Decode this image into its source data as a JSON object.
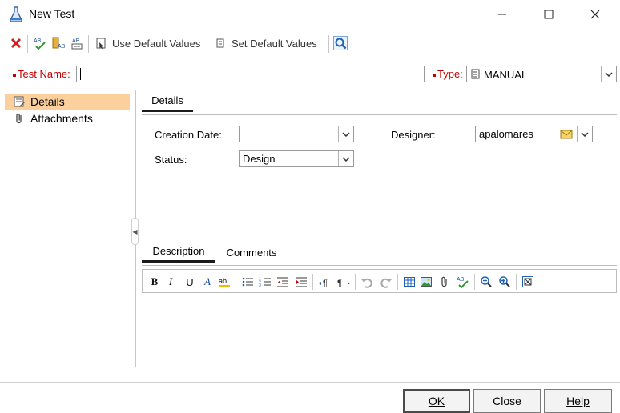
{
  "window": {
    "title": "New Test",
    "controls": {
      "minimize": "minimize-icon",
      "maximize": "maximize-icon",
      "close": "close-icon"
    }
  },
  "toolbar": {
    "use_default_label": "Use Default Values",
    "set_default_label": "Set Default Values",
    "icons": [
      "delete-icon",
      "spell-check-icon",
      "thesaurus-icon",
      "spelling-options-icon",
      "use-default-icon",
      "set-default-icon",
      "search-icon"
    ]
  },
  "form": {
    "test_name_label": "Test Name:",
    "test_name_value": "",
    "type_label": "Type:",
    "type_value": "MANUAL"
  },
  "sidebar": {
    "items": [
      {
        "label": "Details",
        "icon": "details-icon",
        "selected": true
      },
      {
        "label": "Attachments",
        "icon": "paperclip-icon",
        "selected": false
      }
    ]
  },
  "details": {
    "tab_label": "Details",
    "creation_date_label": "Creation Date:",
    "creation_date_value": "",
    "designer_label": "Designer:",
    "designer_value": "apalomares",
    "status_label": "Status:",
    "status_value": "Design"
  },
  "bottom_tabs": [
    {
      "label": "Description",
      "active": true
    },
    {
      "label": "Comments",
      "active": false
    }
  ],
  "rte": {
    "bold": "B",
    "italic": "I",
    "underline": "U",
    "font": "A"
  },
  "buttons": {
    "ok": "OK",
    "close": "Close",
    "help": "Help"
  },
  "colors": {
    "selected_bg": "#fcd09c",
    "required": "#c00000",
    "icon_blue": "#1f5fb4"
  }
}
